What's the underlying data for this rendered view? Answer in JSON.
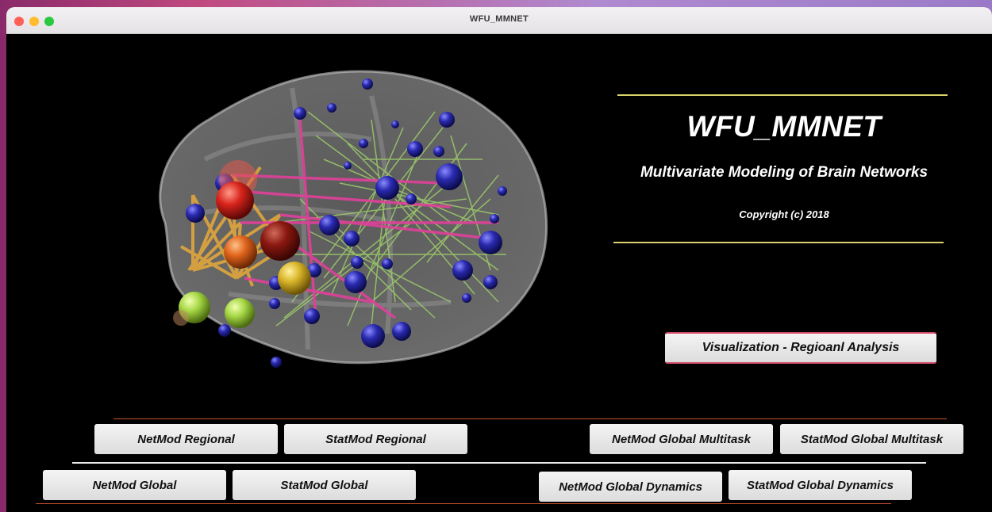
{
  "window": {
    "title": "WFU_MMNET"
  },
  "header": {
    "app_name": "WFU_MMNET",
    "subtitle": "Multivariate Modeling of Brain Networks",
    "copyright": "Copyright (c) 2018"
  },
  "visualization_button": {
    "label": "Visualization - Regioanl Analysis"
  },
  "module_buttons": {
    "netmod_regional": "NetMod Regional",
    "statmod_regional": "StatMod Regional",
    "netmod_global_multitask": "NetMod Global Multitask",
    "statmod_global_multitask": "StatMod Global Multitask",
    "netmod_global": "NetMod Global",
    "statmod_global": "StatMod Global",
    "netmod_global_dynamics": "NetMod Global Dynamics",
    "statmod_global_dynamics": "StatMod Global Dynamics"
  },
  "colors": {
    "background": "#000000",
    "title_rule": "#d9d36a",
    "button_rule": "#c4532d",
    "node_default": "#1a1a8a",
    "edge_positive": "#9ccc6a",
    "edge_negative": "#e0409a",
    "edge_hub": "#e8a93a"
  },
  "graphic": {
    "icon": "brain-network-icon"
  }
}
